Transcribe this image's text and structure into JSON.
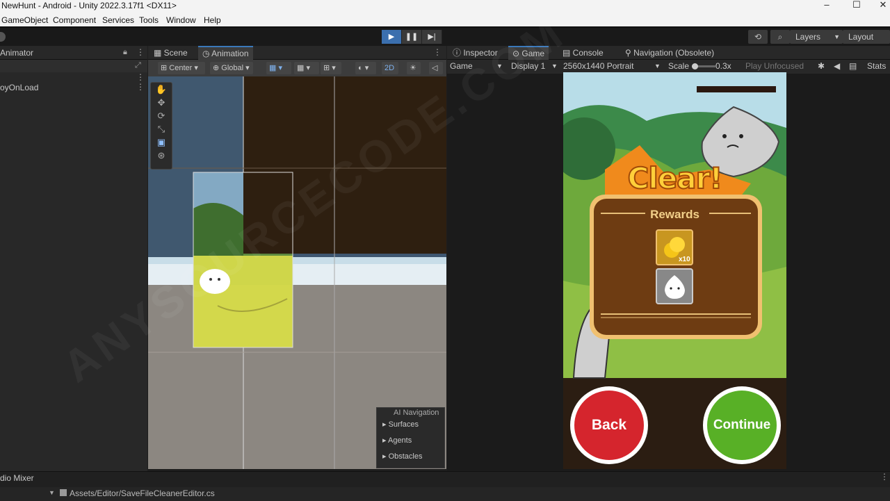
{
  "window": {
    "title": "NewHunt - Android - Unity 2022.3.17f1 <DX11>",
    "controls": [
      "–",
      "☐",
      "✕"
    ]
  },
  "menu": [
    "GameObject",
    "Component",
    "Services",
    "Tools",
    "Window",
    "Help"
  ],
  "toolbar": {
    "play_icons": [
      "▶",
      "❚❚",
      "▶|"
    ],
    "layers_label": "Layers",
    "layout_label": "Layout"
  },
  "left_panel": {
    "tab": "Animator",
    "item": "oyOnLoad"
  },
  "scene_panel": {
    "tabs": [
      "Scene",
      "Animation"
    ],
    "pivot": "Center",
    "space": "Global",
    "mode_2d": "2D"
  },
  "ai_navigation": {
    "title": "AI Navigation",
    "items": [
      "Surfaces",
      "Agents",
      "Obstacles"
    ]
  },
  "game_panel": {
    "tabs": [
      "Inspector",
      "Game",
      "Console",
      "Navigation (Obsolete)"
    ],
    "game_dropdown": "Game",
    "display": "Display 1",
    "resolution": "2560x1440 Portrait",
    "scale_label": "Scale",
    "scale_value": "0.3x",
    "play_mode": "Play Unfocused",
    "stats": "Stats"
  },
  "game": {
    "clear_title": "Clear!",
    "rewards_title": "Rewards",
    "coin_count": "x10",
    "back_label": "Back",
    "continue_label": "Continue"
  },
  "bottom": {
    "mixer_tab": "dio Mixer",
    "path": "Assets/Editor/SaveFileCleanerEditor.cs"
  },
  "colors": {
    "accent": "#3a79bb",
    "back_button": "#d5252d",
    "continue_button": "#58b026",
    "clear_orange": "#f3a21c",
    "rewards_panel": "#6e3c12"
  }
}
